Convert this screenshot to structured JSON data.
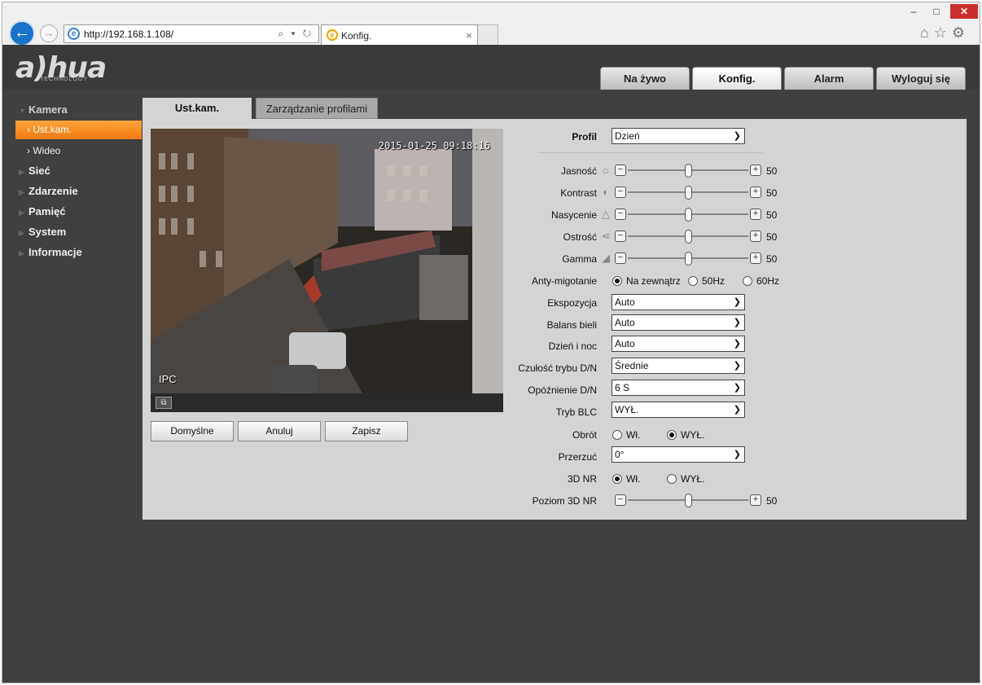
{
  "browser": {
    "url": "http://192.168.1.108/",
    "tab_title": "Konfig.",
    "addr_tools": "⌕ ▾ ↻",
    "win_min": "–",
    "win_max": "□",
    "win_close": "✕",
    "tab_close": "×",
    "right_icons": "⌂☆⚙"
  },
  "app": {
    "logo": "a)hua",
    "logo_sub": "TECHNOLOGY",
    "topnav": [
      "Na żywo",
      "Konfig.",
      "Alarm",
      "Wyloguj się"
    ],
    "active_topnav": "Konfig."
  },
  "sidebar": {
    "camera": "Kamera",
    "camera_items": [
      "Ust.kam.",
      "Wideo"
    ],
    "groups": [
      "Sieć",
      "Zdarzenie",
      "Pamięć",
      "System",
      "Informacje"
    ]
  },
  "content": {
    "tabs": [
      "Ust.kam.",
      "Zarządzanie profilami"
    ],
    "video": {
      "timestamp": "2015-01-25 09:18:16",
      "label": "IPC"
    },
    "buttons": {
      "default": "Domyślne",
      "cancel": "Anuluj",
      "save": "Zapisz"
    },
    "settings": {
      "profile_label": "Profil",
      "profile_value": "Dzień",
      "brightness_label": "Jasność",
      "brightness": 50,
      "contrast_label": "Kontrast",
      "contrast": 50,
      "saturation_label": "Nasycenie",
      "saturation": 50,
      "sharpness_label": "Ostrość",
      "sharpness": 50,
      "gamma_label": "Gamma",
      "gamma": 50,
      "antiflicker_label": "Anty-migotanie",
      "antiflicker_options": [
        "Na zewnątrz",
        "50Hz",
        "60Hz"
      ],
      "antiflicker_selected": "Na zewnątrz",
      "exposure_label": "Ekspozycja",
      "exposure_value": "Auto",
      "wb_label": "Balans bieli",
      "wb_value": "Auto",
      "daynight_label": "Dzień i noc",
      "daynight_value": "Auto",
      "dn_sens_label": "Czułość trybu D/N",
      "dn_sens_value": "Średnie",
      "dn_delay_label": "Opóźnienie D/N",
      "dn_delay_value": "6 S",
      "blc_label": "Tryb BLC",
      "blc_value": "WYŁ.",
      "rotate_label": "Obrót",
      "rotate_options": [
        "Wł.",
        "WYŁ."
      ],
      "rotate_selected": "WYŁ.",
      "flip_label": "Przerzuć",
      "flip_value": "0°",
      "nr3d_label": "3D NR",
      "nr3d_options": [
        "Wł.",
        "WYŁ."
      ],
      "nr3d_selected": "Wł.",
      "nr3d_level_label": "Poziom 3D NR",
      "nr3d_level": 50
    }
  },
  "colors": {
    "accent_orange": "#f07a10",
    "app_bg": "#404040",
    "panel_bg": "#d4d4d4"
  }
}
